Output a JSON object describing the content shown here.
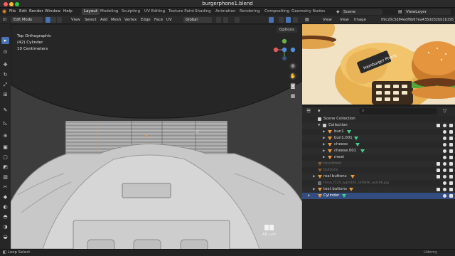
{
  "window": {
    "title": "burgerphone1.blend"
  },
  "menu": {
    "items": [
      "File",
      "Edit",
      "Render",
      "Window",
      "Help"
    ],
    "workspaces": [
      "Layout",
      "Modeling",
      "Sculpting",
      "UV Editing",
      "Texture Paint",
      "Shading",
      "Animation",
      "Rendering",
      "Compositing",
      "Geometry Nodes"
    ],
    "active_workspace": "Layout",
    "scene": "Scene",
    "view_layer": "ViewLayer"
  },
  "viewport_header": {
    "mode": "Edit Mode",
    "menus": [
      "View",
      "Select",
      "Add",
      "Mesh",
      "Vertex",
      "Edge",
      "Face",
      "UV"
    ],
    "orientation": "Global",
    "options": "Options"
  },
  "viewport": {
    "view_name": "Top Orthographic",
    "object": "(42) Cylinder",
    "scale": "10 Centimeters",
    "alt_label": "Alt Left"
  },
  "image_editor": {
    "menus": [
      "View",
      "View",
      "Image"
    ],
    "image_name": "09c20c5d84edf6b67ea435dd32bb1b195...",
    "burger_sticker": "Hamburger Phone"
  },
  "outliner": {
    "rows": [
      {
        "label": "Scene Collection",
        "type": "scene",
        "indent": 0,
        "state": "normal"
      },
      {
        "label": "Collection",
        "type": "collection",
        "indent": 1,
        "state": "normal"
      },
      {
        "label": "bun1",
        "type": "mesh",
        "indent": 2,
        "state": "normal"
      },
      {
        "label": "bun1.001",
        "type": "mesh",
        "indent": 2,
        "state": "normal"
      },
      {
        "label": "cheese",
        "type": "mesh",
        "indent": 2,
        "state": "normal"
      },
      {
        "label": "cheese.001",
        "type": "mesh",
        "indent": 2,
        "state": "normal"
      },
      {
        "label": "meat",
        "type": "mesh",
        "indent": 2,
        "state": "normal"
      },
      {
        "label": "touchtool",
        "type": "mesh",
        "indent": 1,
        "state": "dim"
      },
      {
        "label": "buttons",
        "type": "mesh",
        "indent": 1,
        "state": "dim"
      },
      {
        "label": "real buttons",
        "type": "mesh",
        "indent": 1,
        "state": "normal"
      },
      {
        "label": "fomo_f110_wghl400_GRNOK_opts98.jpg",
        "type": "image",
        "indent": 1,
        "state": "dim"
      },
      {
        "label": "text buttons",
        "type": "mesh",
        "indent": 1,
        "state": "normal"
      },
      {
        "label": "Cylinder",
        "type": "mesh",
        "indent": 1,
        "state": "selected"
      }
    ]
  },
  "statusbar": {
    "left": "Loop Select",
    "right": "Udemy"
  },
  "colors": {
    "accent": "#4772b3",
    "selected_row": "#334d80",
    "mesh_icon": "#f29a38",
    "modifier_icon": "#3fd18a"
  }
}
